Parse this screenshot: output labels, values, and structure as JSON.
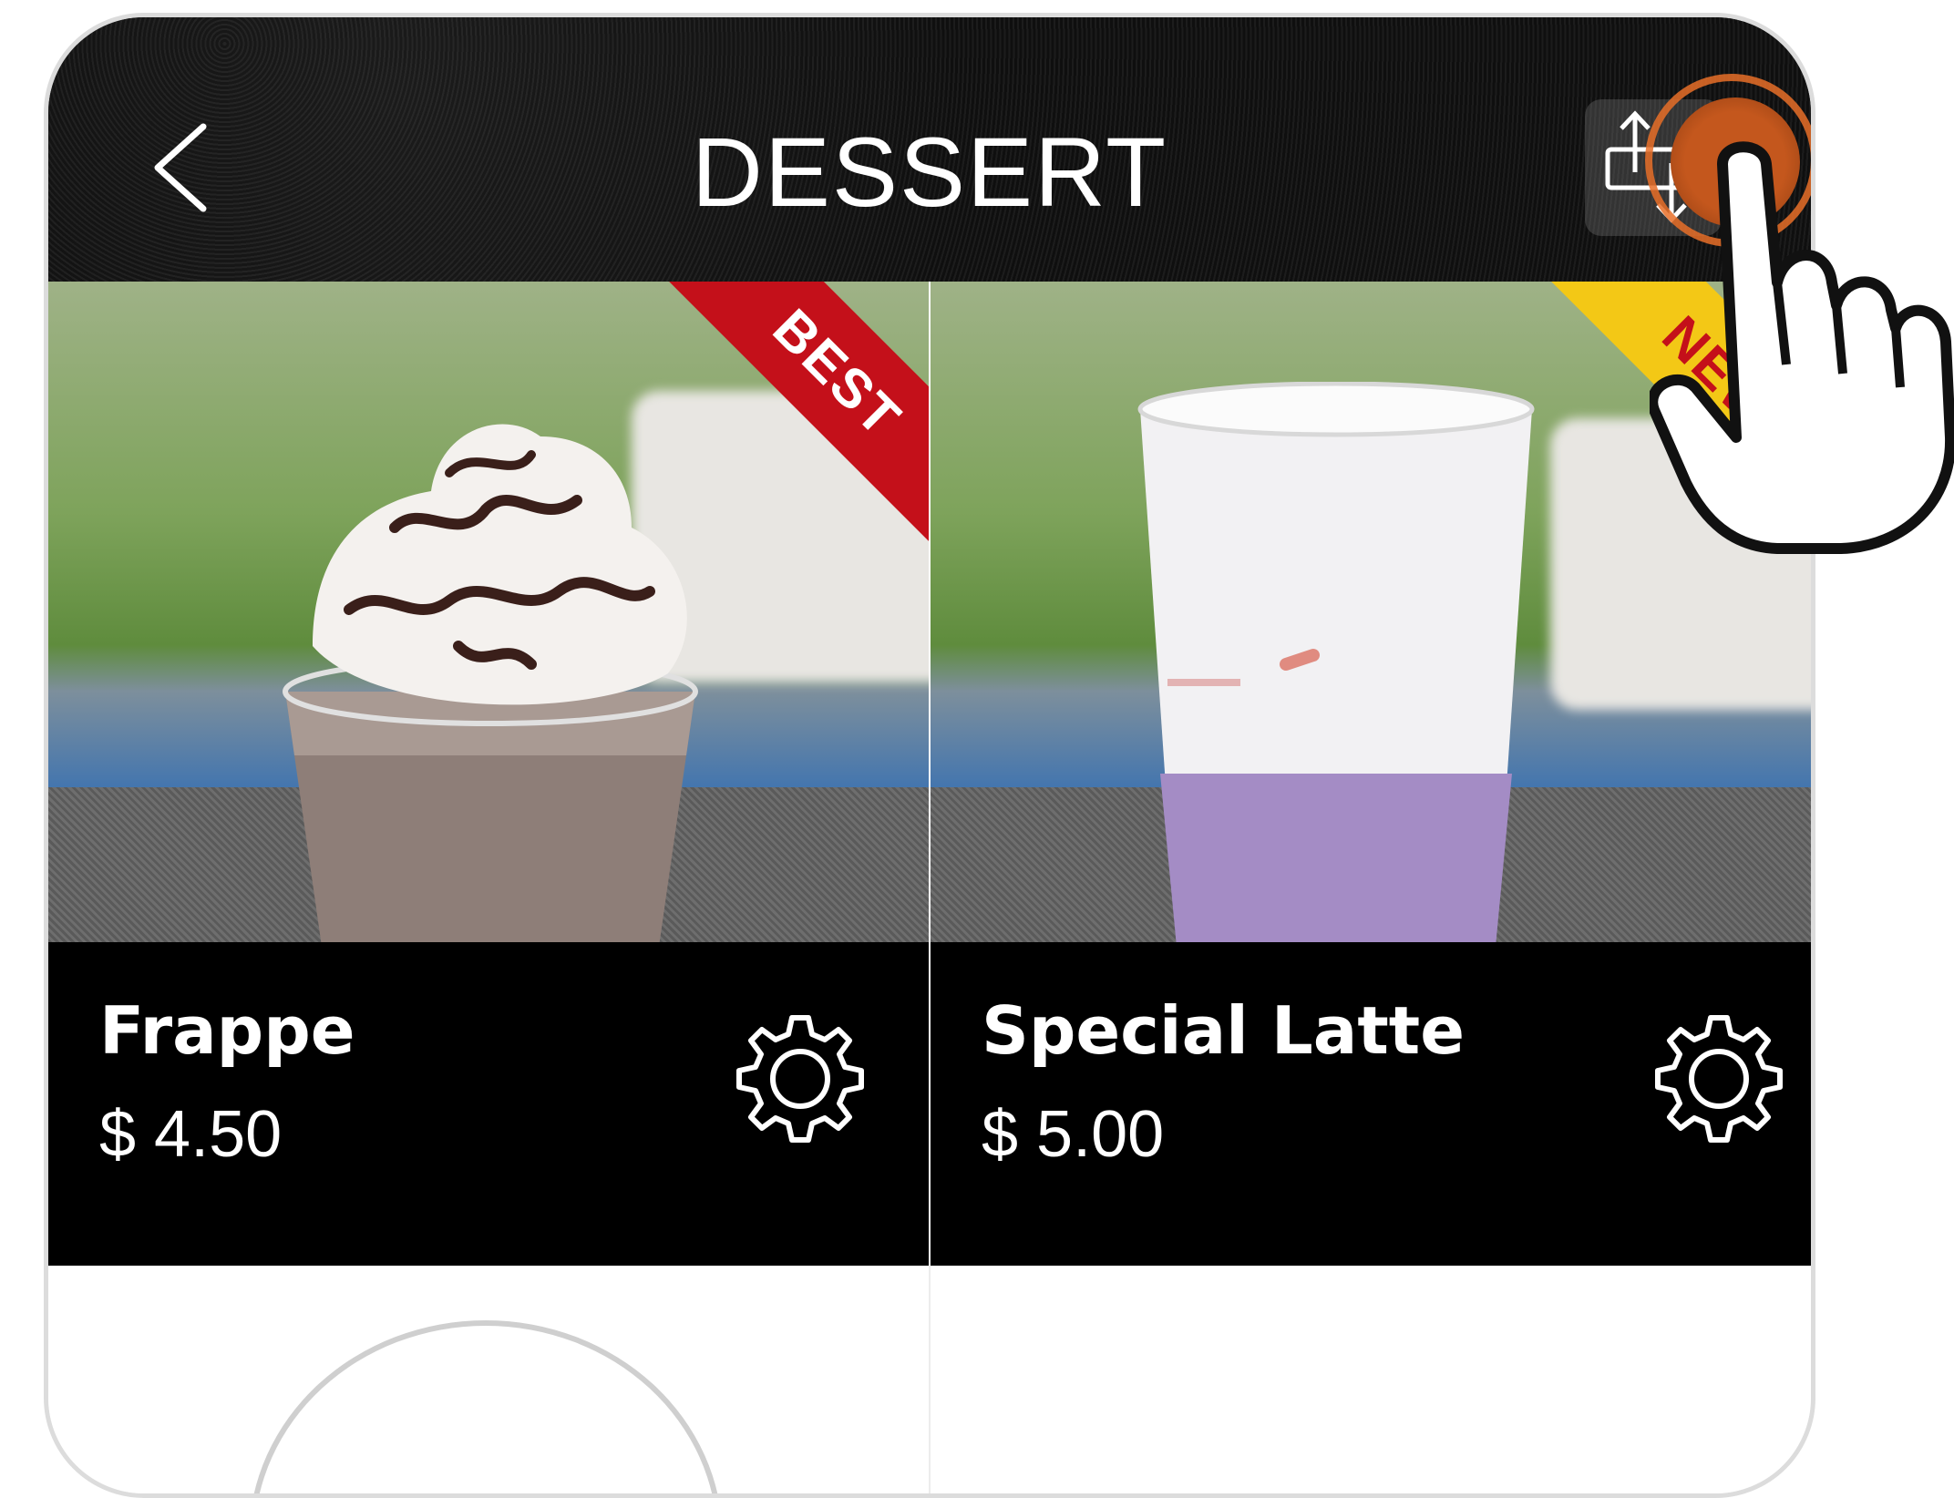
{
  "header": {
    "title": "DESSERT",
    "back_icon": "chevron-left-icon",
    "share_icon": "share-export-icon"
  },
  "products": [
    {
      "name": "Frappe",
      "price": "$ 4.50",
      "badge": "BEST",
      "badge_color": "#c4101a",
      "settings_icon": "gear-icon"
    },
    {
      "name": "Special Latte",
      "price": "$ 5.00",
      "badge": "NEW",
      "badge_color": "#f3c816",
      "settings_icon": "gear-icon"
    }
  ],
  "overlay": {
    "tap_indicator_color": "#e86e28",
    "hand_icon": "pointing-hand-icon"
  }
}
